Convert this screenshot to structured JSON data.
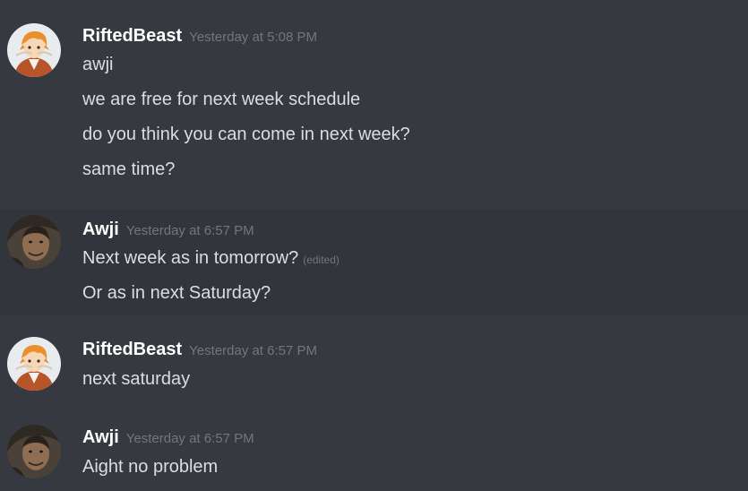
{
  "messages": [
    {
      "author": "RiftedBeast",
      "timestamp": "Yesterday at 5:08 PM",
      "lines": [
        "awji",
        "we are free for next week schedule",
        "do you think you can come in next week?",
        "same time?"
      ]
    },
    {
      "author": "Awji",
      "timestamp": "Yesterday at 6:57 PM",
      "lines": [
        "Next week as in tomorrow?",
        "Or as in next Saturday?"
      ],
      "edited_label": "(edited)"
    },
    {
      "author": "RiftedBeast",
      "timestamp": "Yesterday at 6:57 PM",
      "lines": [
        "next saturday"
      ]
    },
    {
      "author": "Awji",
      "timestamp": "Yesterday at 6:57 PM",
      "lines": [
        "Aight no problem"
      ]
    }
  ],
  "colors": {
    "background": "#36393f",
    "hover_background": "#32353b",
    "username": "#ffffff",
    "message_text": "#dcddde",
    "timestamp": "#72767d"
  }
}
